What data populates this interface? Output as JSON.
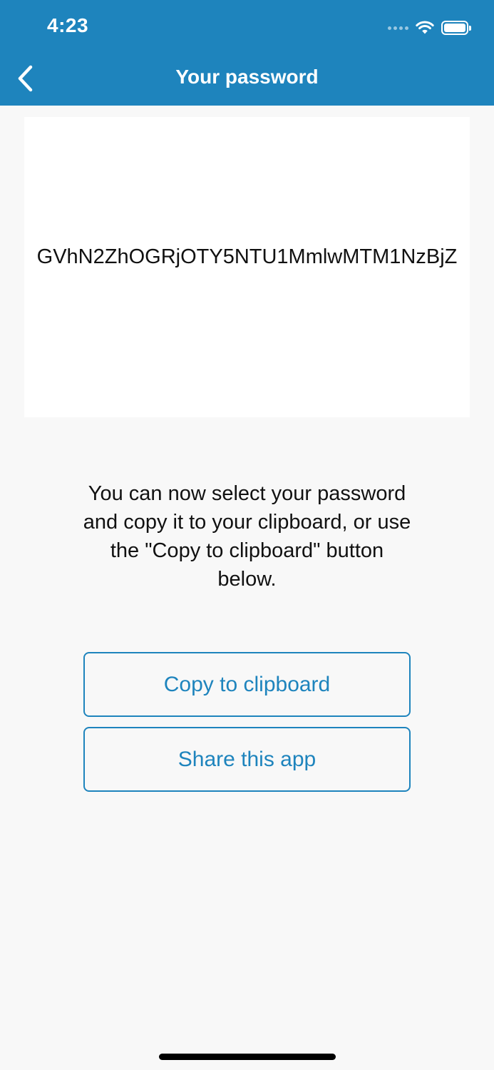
{
  "status_bar": {
    "time": "4:23",
    "wifi_icon": "wifi-icon",
    "battery_icon": "battery-icon",
    "signal_icon": "cellular-signal-icon"
  },
  "nav": {
    "title": "Your password",
    "back_icon": "chevron-left-icon"
  },
  "password": {
    "value": "GVhN2ZhOGRjOTY5NTU1MmlwMTM1NzBjZ"
  },
  "instructions": "You can now select your password and copy it to your clipboard, or use the \"Copy to clipboard\" button below.",
  "buttons": {
    "copy_label": "Copy to clipboard",
    "share_label": "Share this app"
  },
  "colors": {
    "accent": "#1e84bd",
    "background": "#f8f8f8",
    "card": "#ffffff",
    "text": "#111111"
  }
}
